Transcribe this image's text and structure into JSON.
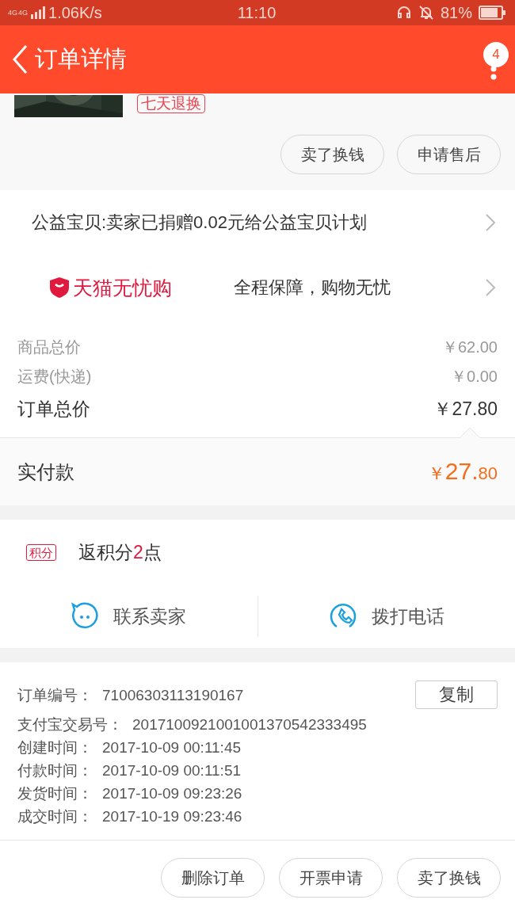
{
  "status_bar": {
    "network_labels": [
      "4G",
      "4G"
    ],
    "speed": "1.06K/s",
    "time": "11:10",
    "battery": "81%"
  },
  "header": {
    "title": "订单详情",
    "badge": "4"
  },
  "product": {
    "tag": "七天退换"
  },
  "top_actions": [
    "卖了换钱",
    "申请售后"
  ],
  "donation": {
    "text": "公益宝贝:卖家已捐赠0.02元给公益宝贝计划"
  },
  "guarantee": {
    "brand": "天猫无忧购",
    "text": "全程保障，购物无忧"
  },
  "prices": [
    {
      "label": "商品总价",
      "value": "￥62.00",
      "kind": "minor"
    },
    {
      "label": "运费(快递)",
      "value": "￥0.00",
      "kind": "minor"
    },
    {
      "label": "订单总价",
      "value": "￥27.80",
      "kind": "total"
    }
  ],
  "paid": {
    "label": "实付款",
    "currency": "￥",
    "integer": "27.",
    "fraction": "80"
  },
  "points": {
    "tag": "积分",
    "prefix": "返积分",
    "value": "2",
    "suffix": "点"
  },
  "contact": [
    {
      "label": "联系卖家",
      "kind": "chat"
    },
    {
      "label": "拨打电话",
      "kind": "phone"
    }
  ],
  "order_info": {
    "copy_button": "复制",
    "rows": [
      {
        "label": "订单编号：",
        "value": "71006303113190167"
      },
      {
        "label": "支付宝交易号：",
        "value": "2017100921001001370542333495"
      },
      {
        "label": "创建时间：",
        "value": "2017-10-09 00:11:45"
      },
      {
        "label": "付款时间：",
        "value": "2017-10-09 00:11:51"
      },
      {
        "label": "发货时间：",
        "value": "2017-10-09 09:23:26"
      },
      {
        "label": "成交时间：",
        "value": "2017-10-19 09:23:46"
      }
    ]
  },
  "bottom_actions": [
    "删除订单",
    "开票申请",
    "卖了换钱"
  ]
}
